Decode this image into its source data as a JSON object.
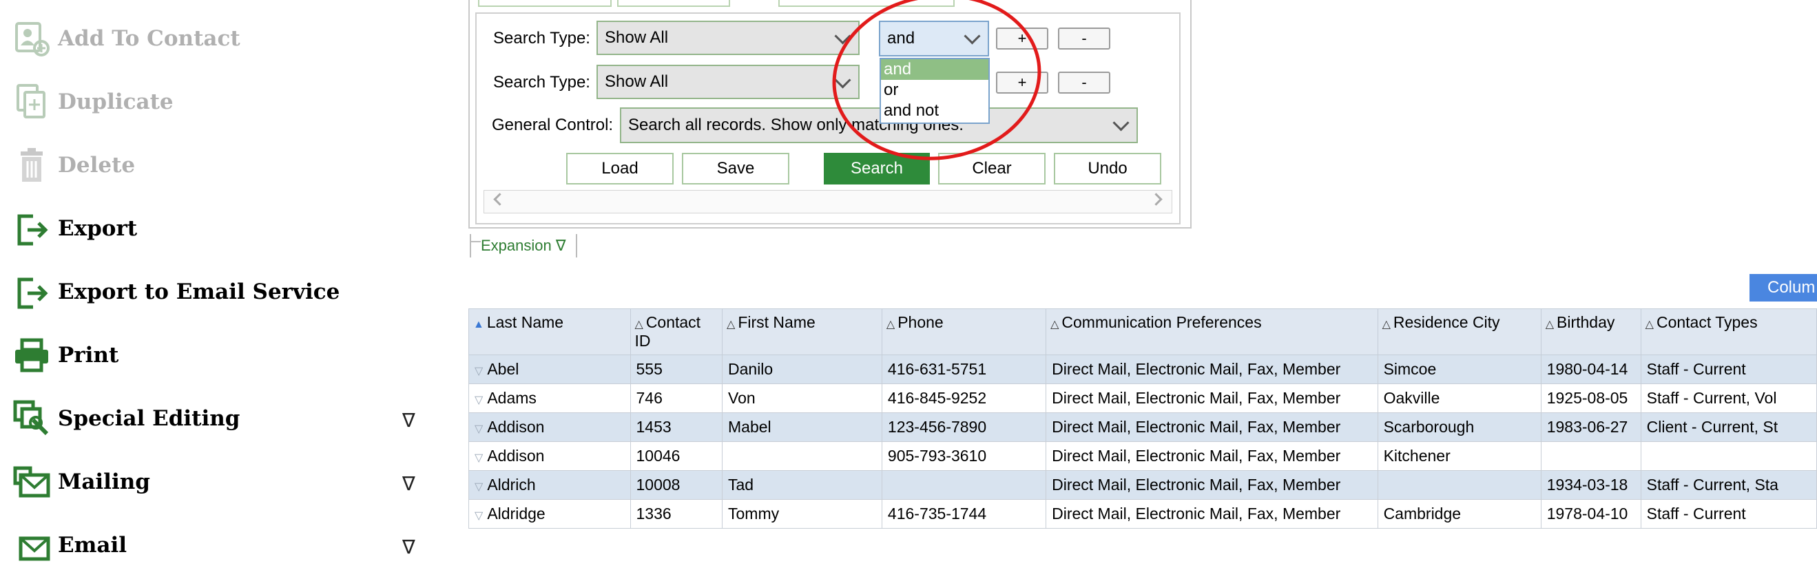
{
  "sidebar": {
    "items": [
      {
        "label": "Add To Contact",
        "icon": "add-contact-icon",
        "disabled": true
      },
      {
        "label": "Duplicate",
        "icon": "duplicate-icon",
        "disabled": true
      },
      {
        "label": "Delete",
        "icon": "trash-icon",
        "disabled": true
      },
      {
        "label": "Export",
        "icon": "export-icon",
        "disabled": false
      },
      {
        "label": "Export to Email Service",
        "icon": "export-icon",
        "disabled": false
      },
      {
        "label": "Print",
        "icon": "printer-icon",
        "disabled": false
      },
      {
        "label": "Special Editing",
        "icon": "special-edit-icon",
        "disabled": false,
        "caret": "∇"
      },
      {
        "label": "Mailing",
        "icon": "mail-icon",
        "disabled": false,
        "caret": "∇"
      },
      {
        "label": "Email",
        "icon": "mail-icon",
        "disabled": false,
        "caret": "∇"
      }
    ]
  },
  "search": {
    "row1": {
      "label": "Search Type:",
      "value": "Show All",
      "operator": "and"
    },
    "row2": {
      "label": "Search Type:",
      "value": "Show All"
    },
    "general": {
      "label": "General Control:",
      "value": "Search all records. Show only matching ones."
    },
    "plus": "+",
    "minus": "-",
    "operator_options": [
      "and",
      "or",
      "and not"
    ],
    "buttons": {
      "load": "Load",
      "save": "Save",
      "search": "Search",
      "clear": "Clear",
      "undo": "Undo"
    }
  },
  "expansion_label": "Expansion ∇",
  "columns_button": "Colum",
  "colors": {
    "accent_green": "#2e8b3a",
    "row_blue": "#d8e3ef",
    "annotation_red": "#e21b1b",
    "columns_blue": "#4a86e0"
  },
  "table": {
    "headers": [
      "Last Name",
      "Contact ID",
      "First Name",
      "Phone",
      "Communication Preferences",
      "Residence City",
      "Birthday",
      "Contact Types"
    ],
    "rows": [
      [
        "Abel",
        "555",
        "Danilo",
        "416-631-5751",
        "Direct Mail, Electronic Mail, Fax, Member",
        "Simcoe",
        "1980-04-14",
        "Staff - Current"
      ],
      [
        "Adams",
        "746",
        "Von",
        "416-845-9252",
        "Direct Mail, Electronic Mail, Fax, Member",
        "Oakville",
        "1925-08-05",
        "Staff - Current, Vol"
      ],
      [
        "Addison",
        "1453",
        "Mabel",
        "123-456-7890",
        "Direct Mail, Electronic Mail, Fax, Member",
        "Scarborough",
        "1983-06-27",
        "Client - Current, St"
      ],
      [
        "Addison",
        "10046",
        "",
        "905-793-3610",
        "Direct Mail, Electronic Mail, Fax, Member",
        "Kitchener",
        "",
        ""
      ],
      [
        "Aldrich",
        "10008",
        "Tad",
        "",
        "Direct Mail, Electronic Mail, Fax, Member",
        "",
        "1934-03-18",
        "Staff - Current, Sta"
      ],
      [
        "Aldridge",
        "1336",
        "Tommy",
        "416-735-1744",
        "Direct Mail, Electronic Mail, Fax, Member",
        "Cambridge",
        "1978-04-10",
        "Staff - Current"
      ]
    ]
  }
}
